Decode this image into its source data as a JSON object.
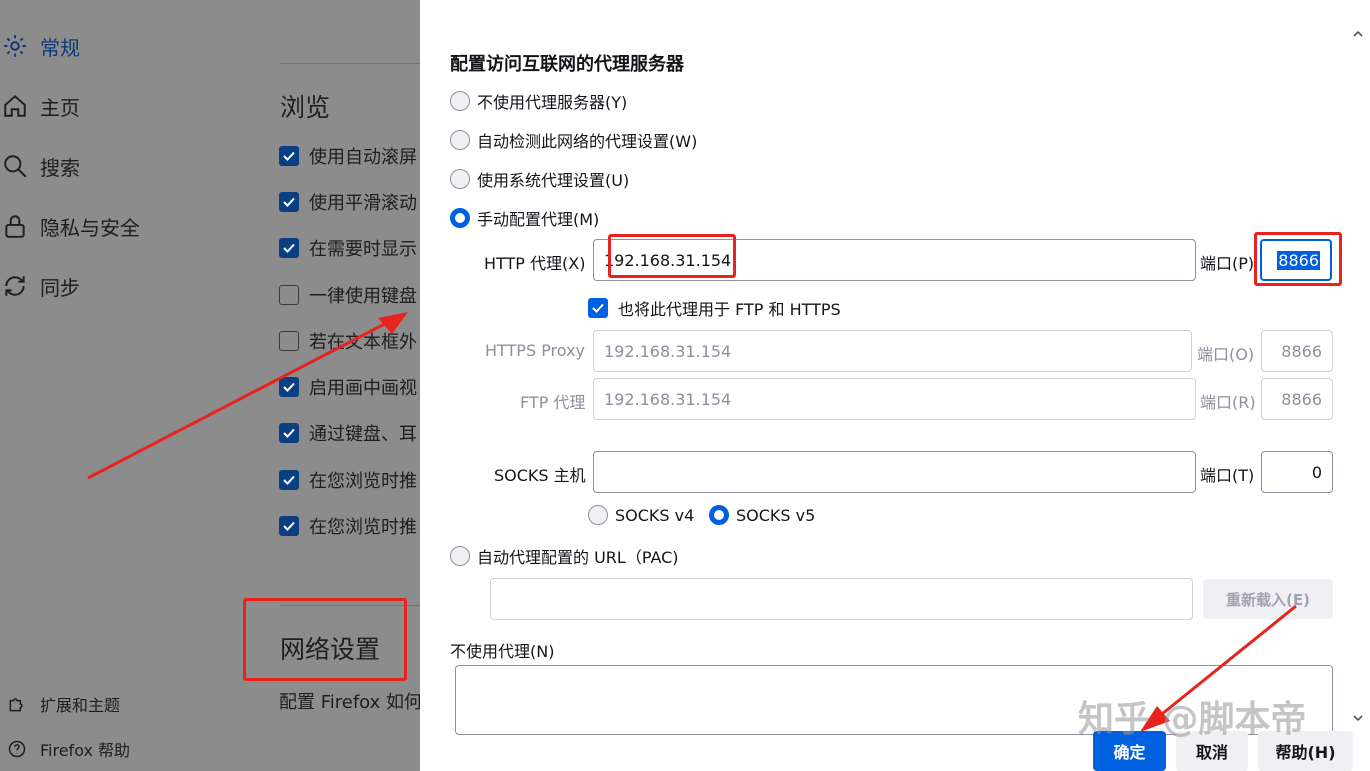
{
  "sidebar": {
    "items": [
      {
        "label": "常规",
        "icon": "gear-icon"
      },
      {
        "label": "主页",
        "icon": "home-icon"
      },
      {
        "label": "搜索",
        "icon": "search-icon"
      },
      {
        "label": "隐私与安全",
        "icon": "lock-icon"
      },
      {
        "label": "同步",
        "icon": "sync-icon"
      }
    ],
    "footer": [
      {
        "label": "扩展和主题",
        "icon": "puzzle-icon"
      },
      {
        "label": "Firefox 帮助",
        "icon": "help-icon"
      }
    ]
  },
  "background": {
    "browse_heading": "浏览",
    "checkboxes": [
      {
        "label": "使用自动滚屏",
        "checked": true
      },
      {
        "label": "使用平滑滚动",
        "checked": true
      },
      {
        "label": "在需要时显示",
        "checked": true
      },
      {
        "label": "一律使用键盘",
        "checked": false
      },
      {
        "label": "若在文本框外",
        "checked": false
      },
      {
        "label": "启用画中画视",
        "checked": true
      },
      {
        "label": "通过键盘、耳",
        "checked": true
      },
      {
        "label": "在您浏览时推",
        "checked": true
      },
      {
        "label": "在您浏览时推",
        "checked": true
      }
    ],
    "network_heading": "网络设置",
    "network_desc": "配置 Firefox 如何"
  },
  "dialog": {
    "title": "配置访问互联网的代理服务器",
    "options": {
      "no_proxy": "不使用代理服务器(Y)",
      "auto_detect": "自动检测此网络的代理设置(W)",
      "system": "使用系统代理设置(U)",
      "manual": "手动配置代理(M)",
      "pac": "自动代理配置的 URL（PAC)"
    },
    "selected_option": "manual",
    "http": {
      "label": "HTTP 代理(X)",
      "value": "192.168.31.154",
      "port_label": "端口(P)",
      "port": "8866"
    },
    "also_use": {
      "label": "也将此代理用于 FTP 和 HTTPS",
      "checked": true
    },
    "https": {
      "label": "HTTPS Proxy",
      "value": "192.168.31.154",
      "port_label": "端口(O)",
      "port": "8866"
    },
    "ftp": {
      "label": "FTP 代理",
      "value": "192.168.31.154",
      "port_label": "端口(R)",
      "port": "8866"
    },
    "socks": {
      "label": "SOCKS 主机",
      "value": "",
      "port_label": "端口(T)",
      "port": "0",
      "v4": "SOCKS v4",
      "v5": "SOCKS v5",
      "selected": "v5"
    },
    "pac_url": "",
    "reload_button": "重新载入(E)",
    "no_proxy_for_label": "不使用代理(N)",
    "buttons": {
      "ok": "确定",
      "cancel": "取消",
      "help": "帮助(H)"
    }
  },
  "watermark": "知乎 @脚本帝",
  "colors": {
    "accent": "#0061e0",
    "annotation": "#e8231d"
  }
}
